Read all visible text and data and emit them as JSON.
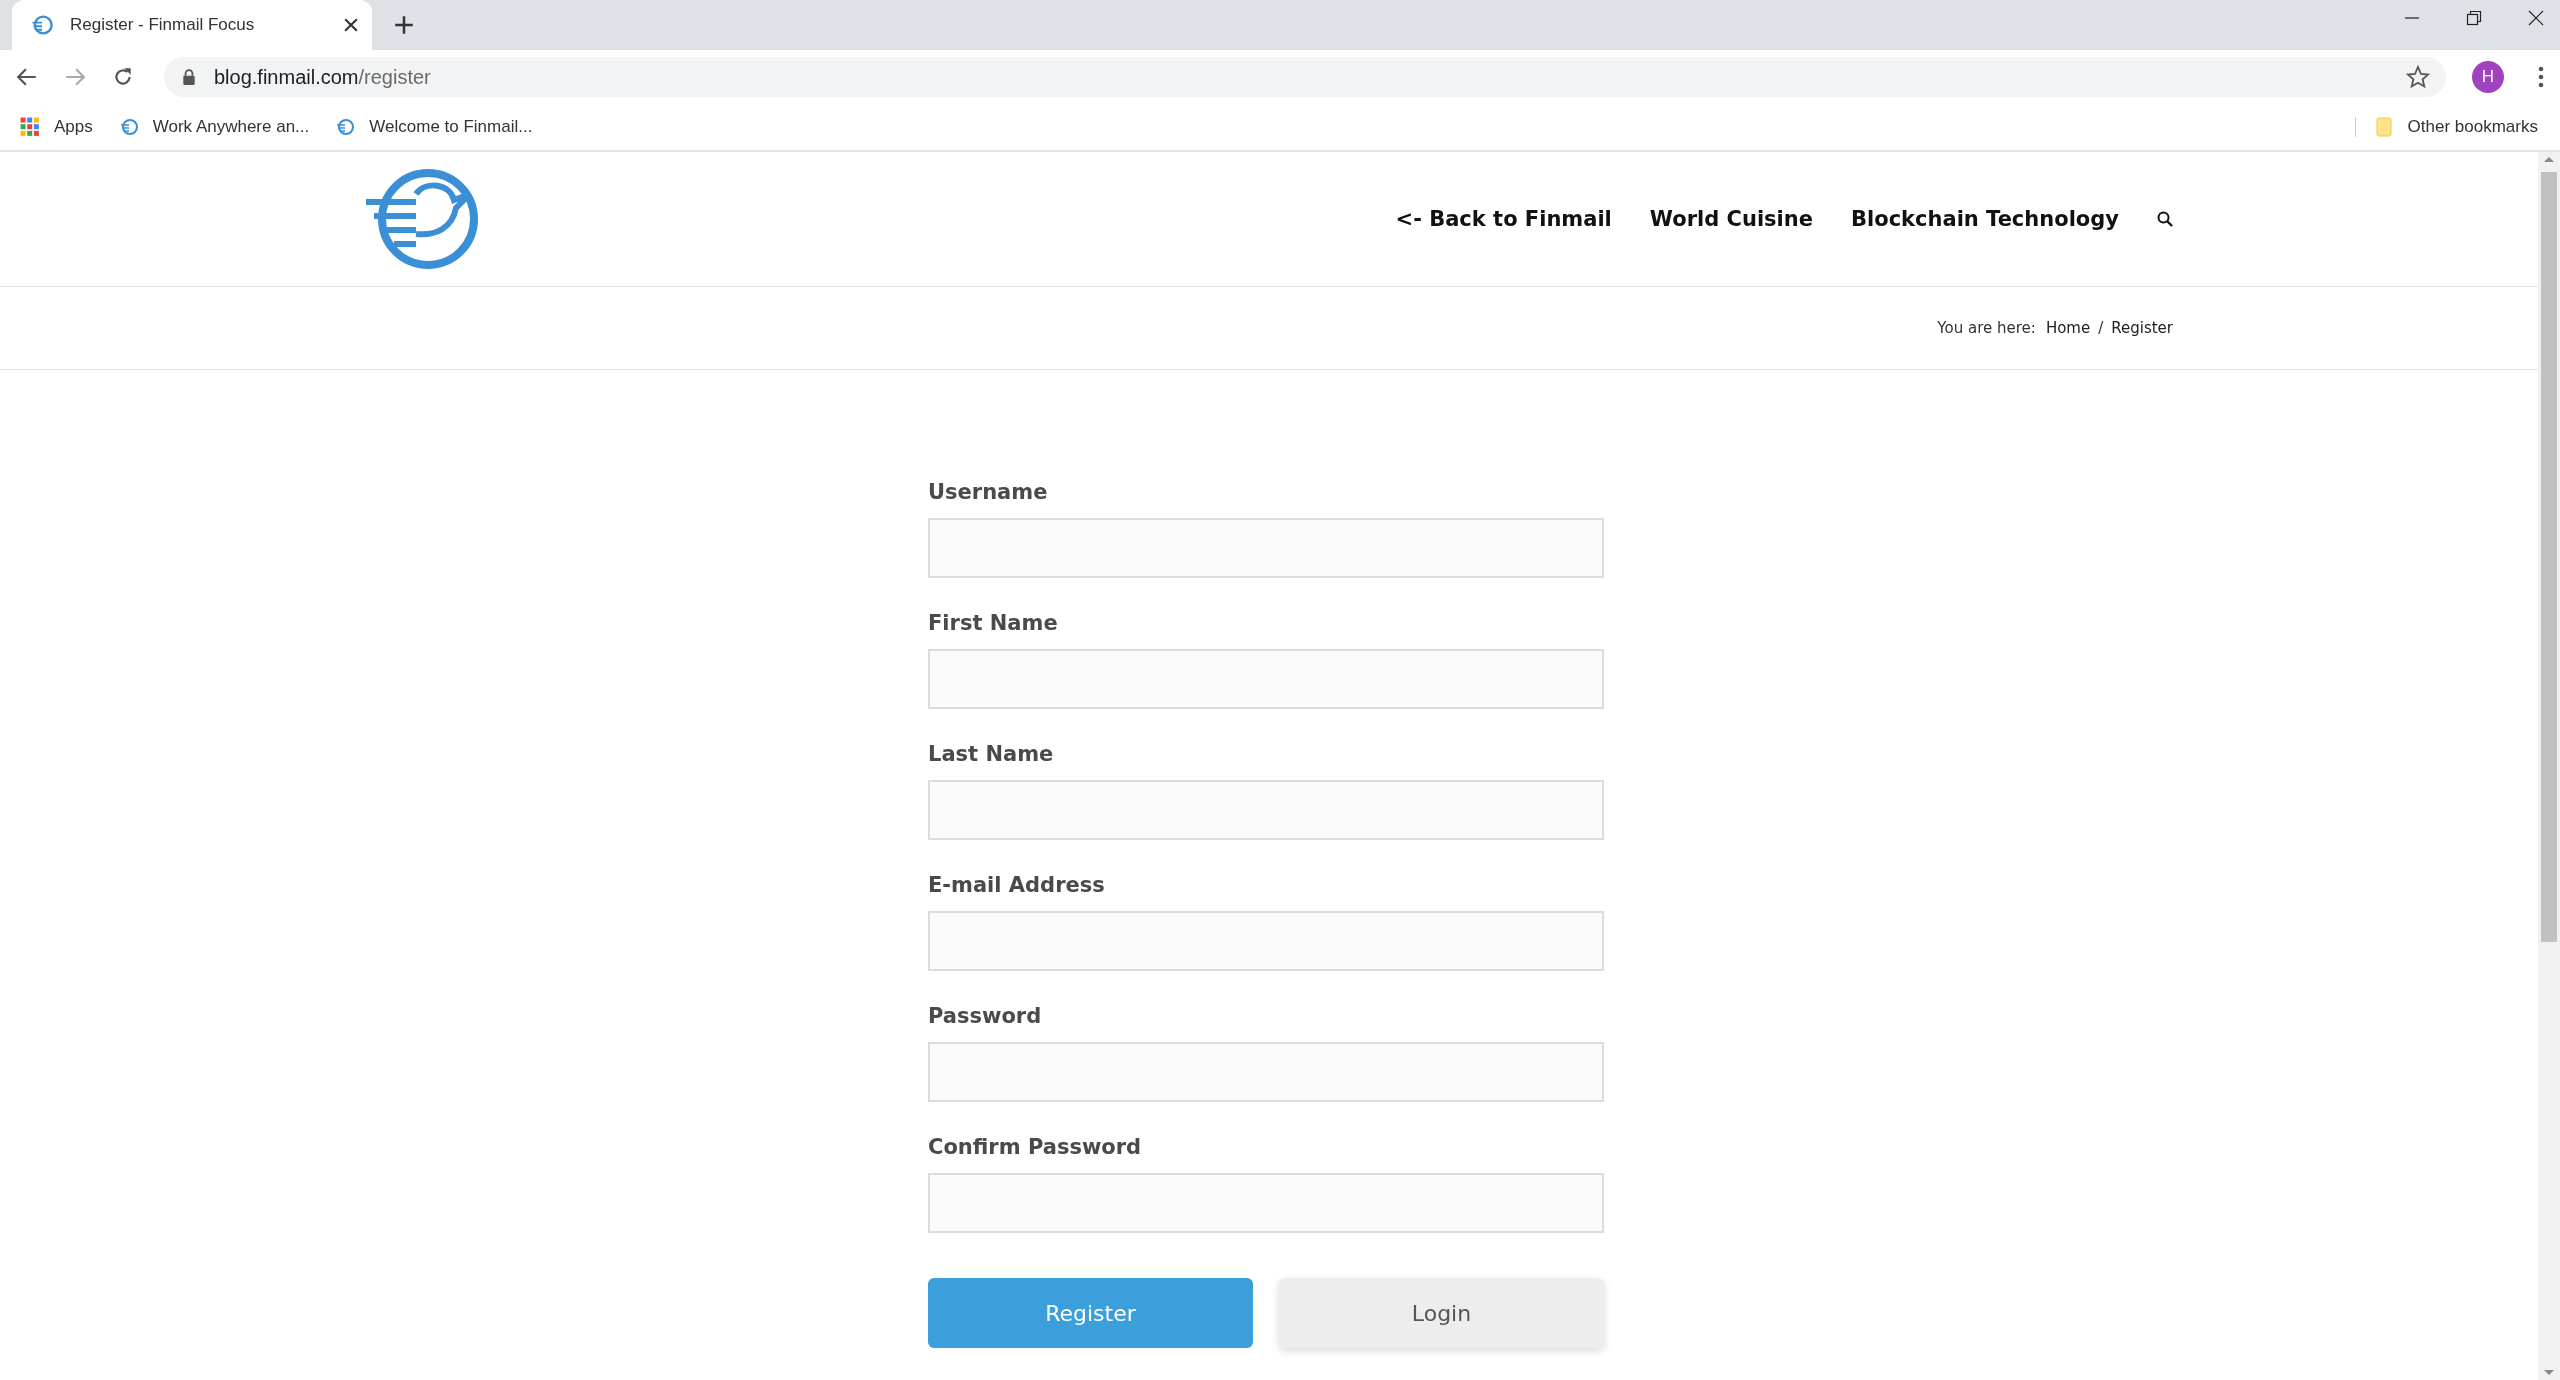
{
  "browser": {
    "tab": {
      "title": "Register - Finmail Focus",
      "selected": true
    },
    "url_host": "blog.finmail.com",
    "url_path": "/register",
    "avatar": "H",
    "bookmarks": [
      {
        "kind": "apps",
        "label": "Apps"
      },
      {
        "kind": "site",
        "label": "Work Anywhere an..."
      },
      {
        "kind": "site",
        "label": "Welcome to Finmail..."
      }
    ],
    "other_bookmarks": "Other bookmarks"
  },
  "nav": {
    "items": [
      "<- Back to Finmail",
      "World Cuisine",
      "Blockchain Technology"
    ]
  },
  "breadcrumb": {
    "label": "You are here:",
    "items": [
      "Home",
      "Register"
    ],
    "separator": "/"
  },
  "form": {
    "fields": [
      {
        "label": "Username"
      },
      {
        "label": "First Name"
      },
      {
        "label": "Last Name"
      },
      {
        "label": "E-mail Address"
      },
      {
        "label": "Password"
      },
      {
        "label": "Confirm Password"
      }
    ],
    "buttons": [
      {
        "kind": "primary",
        "label": "Register"
      },
      {
        "kind": "secondary",
        "label": "Login"
      }
    ]
  }
}
